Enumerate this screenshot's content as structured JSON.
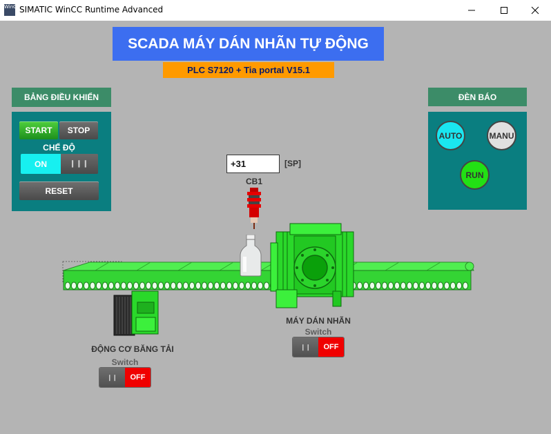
{
  "window": {
    "app_icon_text": "WinCC",
    "title": "SIMATIC WinCC Runtime Advanced",
    "minimize_icon": "minimize-icon",
    "maximize_icon": "maximize-icon",
    "close_icon": "close-icon"
  },
  "header": {
    "title": "SCADA MÁY DÁN NHÃN TỰ ĐỘNG",
    "subtitle": "PLC S7120 + Tia portal V15.1"
  },
  "control_panel": {
    "title": "BẢNG ĐIỀU KHIỂN",
    "start_label": "START",
    "stop_label": "STOP",
    "mode_label": "CHẾ ĐỘ",
    "mode_on_label": "ON",
    "mode_off_label": "❙❙❙",
    "reset_label": "RESET"
  },
  "indicator_panel": {
    "title": "ĐÈN BÁO",
    "auto_label": "AUTO",
    "manu_label": "MANU",
    "run_label": "RUN"
  },
  "sensor": {
    "value": "+31",
    "unit": "[SP]",
    "name": "CB1"
  },
  "conveyor_motor": {
    "label": "ĐỘNG CƠ BĂNG TẢI",
    "sub_label": "Switch",
    "switch_off_side": "❙❙",
    "switch_state": "OFF"
  },
  "labeler": {
    "label": "MÁY DÁN NHÃN",
    "sub_label": "Switch",
    "switch_off_side": "❙❙",
    "switch_state": "OFF"
  },
  "colors": {
    "background": "#b4b4b4",
    "title_blue": "#3c6ef0",
    "subtitle_orange": "#ff9a00",
    "panel_teal": "#0a7e80",
    "panel_header_green": "#3c8c68",
    "auto_lamp": "#1ae6f0",
    "manu_lamp": "#e0e0e0",
    "run_lamp": "#22e014",
    "switch_red": "#f00000",
    "machine_green": "#3cf03c"
  }
}
